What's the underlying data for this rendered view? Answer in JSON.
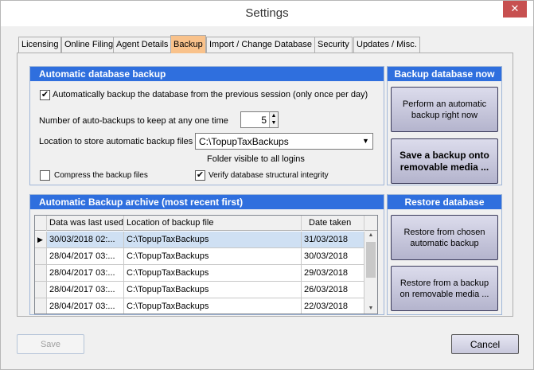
{
  "window": {
    "title": "Settings",
    "close_glyph": "✕"
  },
  "tabs": [
    {
      "label": "Licensing"
    },
    {
      "label": "Online Filing"
    },
    {
      "label": "Agent Details"
    },
    {
      "label": "Backup"
    },
    {
      "label": "Import / Change Database"
    },
    {
      "label": "Security"
    },
    {
      "label": "Updates / Misc."
    }
  ],
  "auto_backup": {
    "header": "Automatic database backup",
    "auto_checkbox": {
      "label": "Automatically backup the database from the previous session (only once per day)",
      "checked": true,
      "glyph": "✔"
    },
    "count_label": "Number of auto-backups to keep at any one time",
    "count_value": "5",
    "location_label": "Location to store automatic backup files",
    "location_value": "C:\\TopupTaxBackups",
    "folder_note": "Folder visible to all logins",
    "compress_checkbox": {
      "label": "Compress the backup files",
      "checked": false,
      "glyph": ""
    },
    "verify_checkbox": {
      "label": "Verify database structural integrity",
      "checked": true,
      "glyph": "✔"
    }
  },
  "backup_now": {
    "header": "Backup database now",
    "perform_button": "Perform an automatic backup right now",
    "removable_button": "Save a backup onto removable media ..."
  },
  "archive": {
    "header": "Automatic Backup archive (most recent first)",
    "columns": [
      "Data was last used",
      "Location of backup file",
      "Date taken"
    ],
    "current_marker": "▶",
    "rows": [
      {
        "last_used": "30/03/2018 02:...",
        "location": "C:\\TopupTaxBackups",
        "date_taken": "31/03/2018"
      },
      {
        "last_used": "28/04/2017 03:...",
        "location": "C:\\TopupTaxBackups",
        "date_taken": "30/03/2018"
      },
      {
        "last_used": "28/04/2017 03:...",
        "location": "C:\\TopupTaxBackups",
        "date_taken": "29/03/2018"
      },
      {
        "last_used": "28/04/2017 03:...",
        "location": "C:\\TopupTaxBackups",
        "date_taken": "26/03/2018"
      },
      {
        "last_used": "28/04/2017 03:...",
        "location": "C:\\TopupTaxBackups",
        "date_taken": "22/03/2018"
      }
    ]
  },
  "restore": {
    "header": "Restore database",
    "chosen_button": "Restore from chosen automatic backup",
    "removable_button": "Restore from a backup on removable media ..."
  },
  "footer": {
    "save_label": "Save",
    "cancel_label": "Cancel"
  }
}
